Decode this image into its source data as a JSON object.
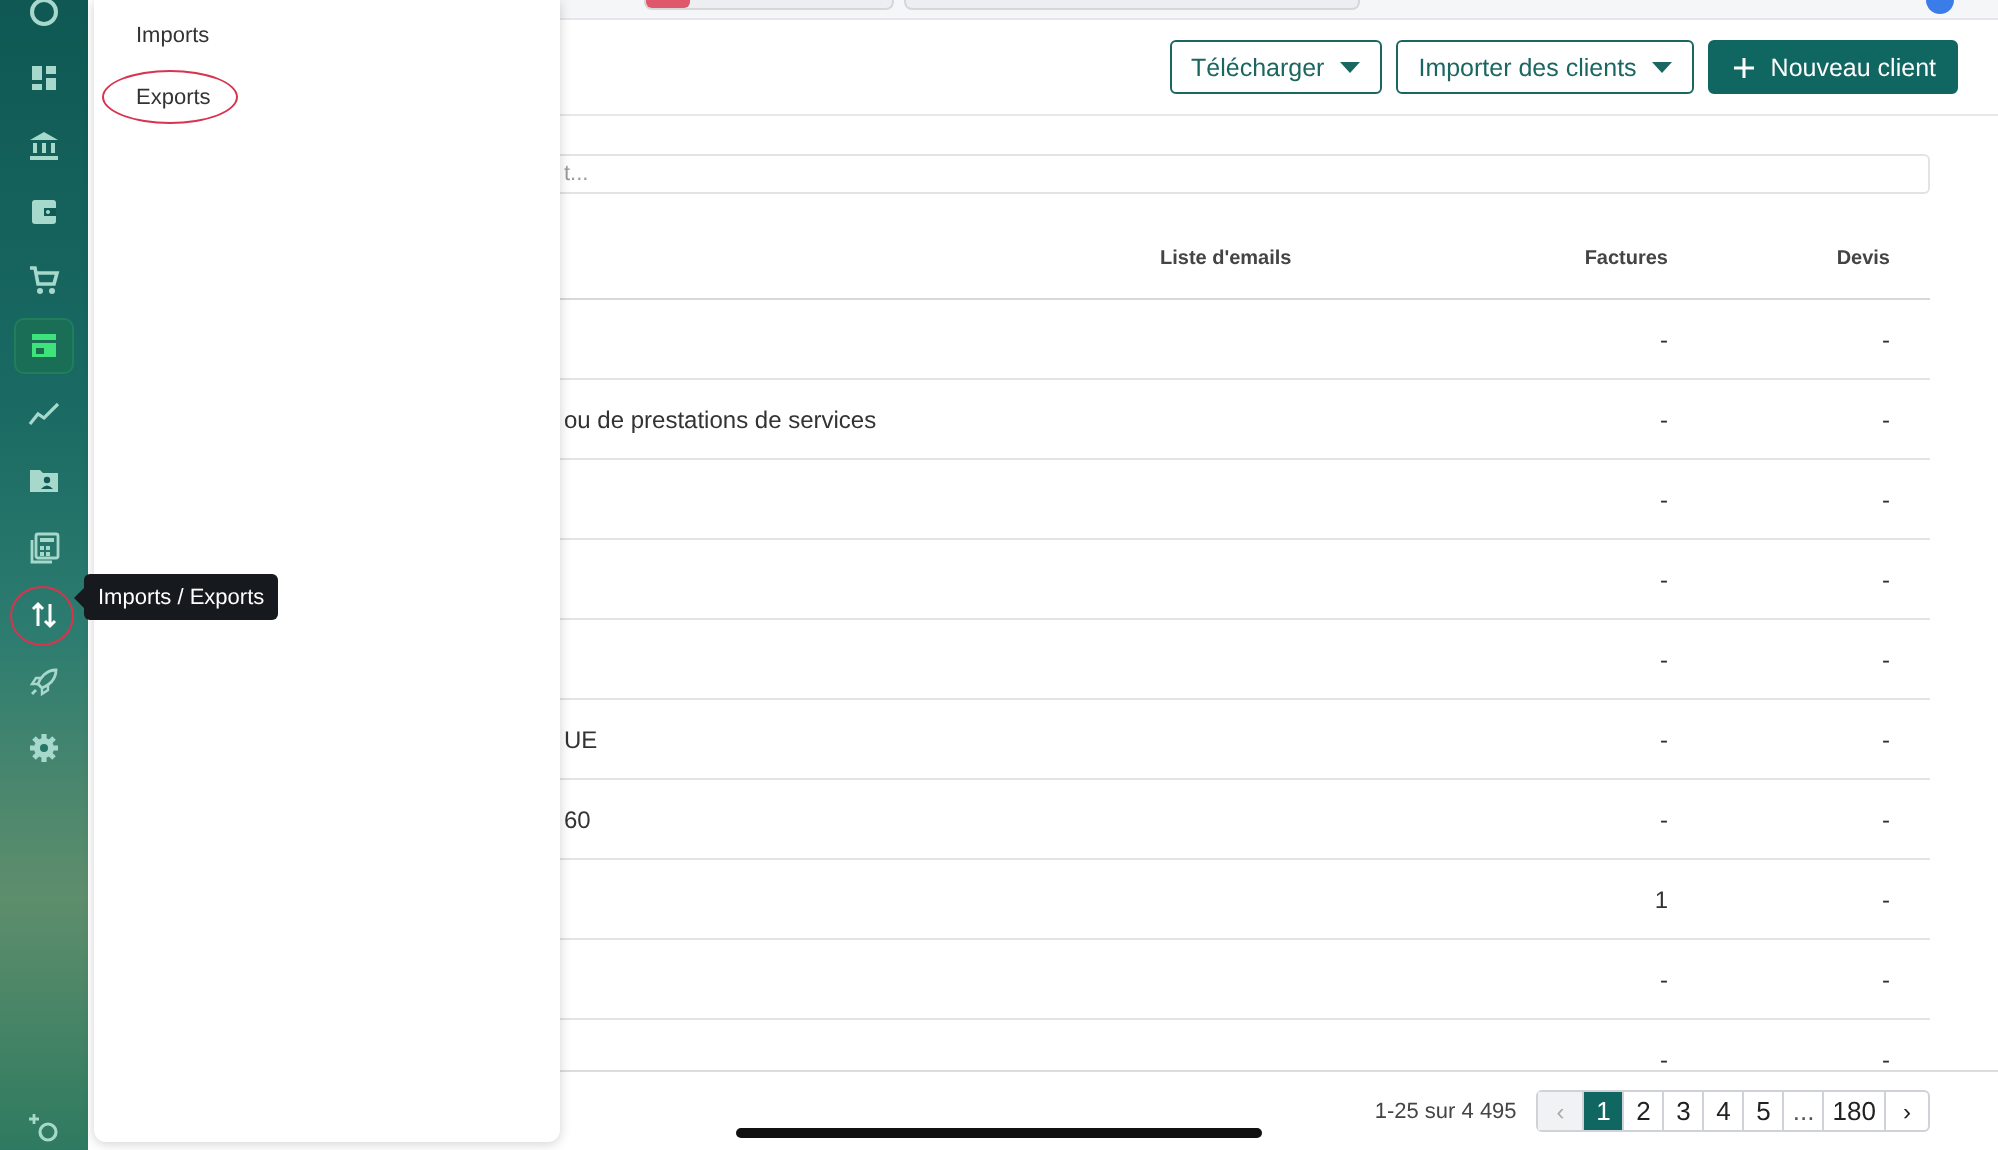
{
  "rail": {
    "items": [
      {
        "kind": "logo",
        "selected": false,
        "circled": false
      },
      {
        "kind": "dashboard",
        "selected": false,
        "circled": false
      },
      {
        "kind": "bank",
        "selected": false,
        "circled": false
      },
      {
        "kind": "wallet",
        "selected": false,
        "circled": false
      },
      {
        "kind": "cart",
        "selected": false,
        "circled": false
      },
      {
        "kind": "shop",
        "selected": true,
        "circled": false
      },
      {
        "kind": "chart",
        "selected": false,
        "circled": false
      },
      {
        "kind": "folder",
        "selected": false,
        "circled": false
      },
      {
        "kind": "calculator",
        "selected": false,
        "circled": false
      },
      {
        "kind": "transfer",
        "selected": false,
        "circled": true
      },
      {
        "kind": "rocket",
        "selected": false,
        "circled": false
      },
      {
        "kind": "gear",
        "selected": false,
        "circled": false
      }
    ],
    "bottom_items": [
      {
        "kind": "sparkle",
        "selected": false,
        "circled": false
      }
    ],
    "tooltip": "Imports / Exports"
  },
  "flyout": {
    "items": [
      {
        "label": "Imports",
        "circled": false
      },
      {
        "label": "Exports",
        "circled": true
      }
    ]
  },
  "header": {
    "buttons": [
      {
        "kind": "dropdown",
        "label": "Télécharger"
      },
      {
        "kind": "dropdown",
        "label": "Importer des clients"
      },
      {
        "kind": "primary",
        "label": "Nouveau client"
      }
    ]
  },
  "search": {
    "placeholder": "t..."
  },
  "table": {
    "columns": [
      {
        "label": "Liste d'emails"
      },
      {
        "label": "Factures"
      },
      {
        "label": "Devis"
      }
    ],
    "rows": [
      {
        "factures": "-",
        "devis": "-"
      },
      {
        "column_1": "ou de prestations de services",
        "factures": "-",
        "devis": "-"
      },
      {
        "factures": "-",
        "devis": "-"
      },
      {
        "factures": "-",
        "devis": "-"
      },
      {
        "factures": "-",
        "devis": "-"
      },
      {
        "column_1": "UE",
        "factures": "-",
        "devis": "-"
      },
      {
        "column_1": "60",
        "factures": "-",
        "devis": "-"
      },
      {
        "factures": "1",
        "devis": "-"
      },
      {
        "factures": "-",
        "devis": "-"
      },
      {
        "factures": "-",
        "devis": "-"
      }
    ]
  },
  "pagination": {
    "summary": "1-25 sur 4 495",
    "pages": [
      {
        "kind": "prev",
        "label": "‹",
        "selected": false,
        "disabled": true
      },
      {
        "kind": "page",
        "label": "1",
        "selected": true,
        "disabled": false
      },
      {
        "kind": "page",
        "label": "2",
        "selected": false,
        "disabled": false
      },
      {
        "kind": "page",
        "label": "3",
        "selected": false,
        "disabled": false
      },
      {
        "kind": "page",
        "label": "4",
        "selected": false,
        "disabled": false
      },
      {
        "kind": "page",
        "label": "5",
        "selected": false,
        "disabled": false
      },
      {
        "kind": "gap",
        "label": "...",
        "selected": false,
        "disabled": false
      },
      {
        "kind": "page",
        "label": "180",
        "selected": false,
        "disabled": false
      },
      {
        "kind": "next",
        "label": "›",
        "selected": false,
        "disabled": false
      }
    ]
  }
}
